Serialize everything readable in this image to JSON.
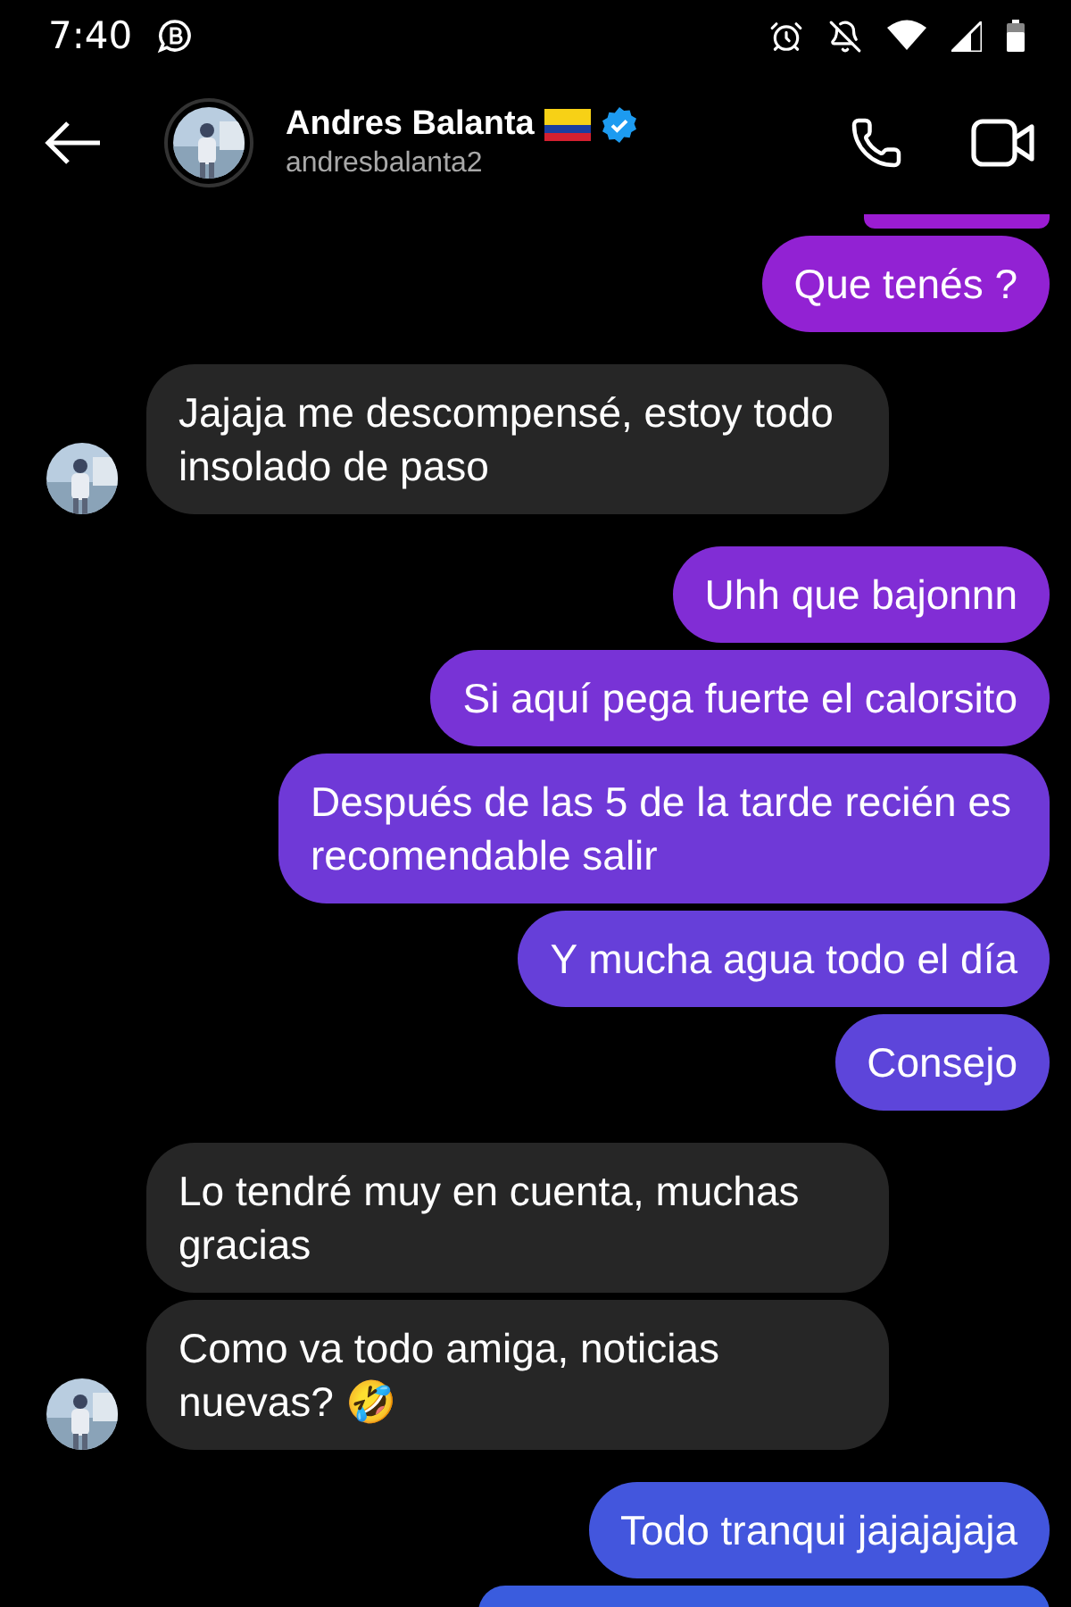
{
  "status_bar": {
    "time": "7:40"
  },
  "header": {
    "name": "Andres Balanta",
    "verified": true,
    "username": "andresbalanta2"
  },
  "messages": [
    {
      "kind": "sent"
    },
    {
      "kind": "sent",
      "text": "Que tenés ?"
    },
    {
      "kind": "received",
      "text": "Jajaja me descompensé, estoy todo insolado de paso",
      "avatar": true
    },
    {
      "kind": "sent",
      "text": "Uhh que bajonnn"
    },
    {
      "kind": "sent",
      "text": "Si aquí pega fuerte el calorsito"
    },
    {
      "kind": "sent",
      "text": "Después de las 5 de la tarde recién es recomendable salir"
    },
    {
      "kind": "sent",
      "text": "Y mucha agua todo el día"
    },
    {
      "kind": "sent",
      "text": "Consejo"
    },
    {
      "kind": "received",
      "text": "Lo tendré muy en cuenta, muchas gracias",
      "avatar": false
    },
    {
      "kind": "received",
      "text": "Como va todo amiga, noticias nuevas? 🤣",
      "avatar": true
    },
    {
      "kind": "sent",
      "text": "Todo tranqui jajajajaja"
    },
    {
      "kind": "sent"
    }
  ]
}
